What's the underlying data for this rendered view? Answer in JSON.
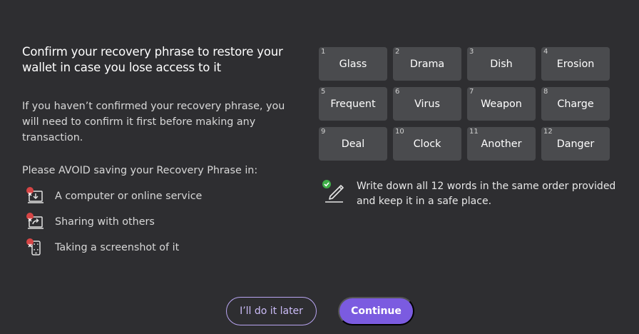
{
  "heading": "Confirm your recovery phrase to restore your wallet in case you lose access to it",
  "paragraph": "If you haven’t confirmed your recovery phrase, you will need to confirm it first before making any transaction.",
  "avoid": {
    "title": "Please AVOID saving your Recovery Phrase in:",
    "items": [
      {
        "label": "A computer or online service",
        "icon": "computer-download-icon"
      },
      {
        "label": "Sharing with others",
        "icon": "share-icon"
      },
      {
        "label": "Taking a screenshot of it",
        "icon": "phone-screenshot-icon"
      }
    ]
  },
  "words": [
    {
      "num": "1",
      "word": "Glass"
    },
    {
      "num": "2",
      "word": "Drama"
    },
    {
      "num": "3",
      "word": "Dish"
    },
    {
      "num": "4",
      "word": "Erosion"
    },
    {
      "num": "5",
      "word": "Frequent"
    },
    {
      "num": "6",
      "word": "Virus"
    },
    {
      "num": "7",
      "word": "Weapon"
    },
    {
      "num": "8",
      "word": "Charge"
    },
    {
      "num": "9",
      "word": "Deal"
    },
    {
      "num": "10",
      "word": "Clock"
    },
    {
      "num": "11",
      "word": "Another"
    },
    {
      "num": "12",
      "word": "Danger"
    }
  ],
  "note": "Write down all 12 words in the same order provided and keep it in a safe place.",
  "buttons": {
    "later": "I’ll do it later",
    "continue": "Continue"
  },
  "colors": {
    "background": "#2e2e31",
    "accent": "#7b5be0",
    "tile": "#4a4b4e",
    "danger": "#d64545",
    "success": "#3fae48"
  }
}
